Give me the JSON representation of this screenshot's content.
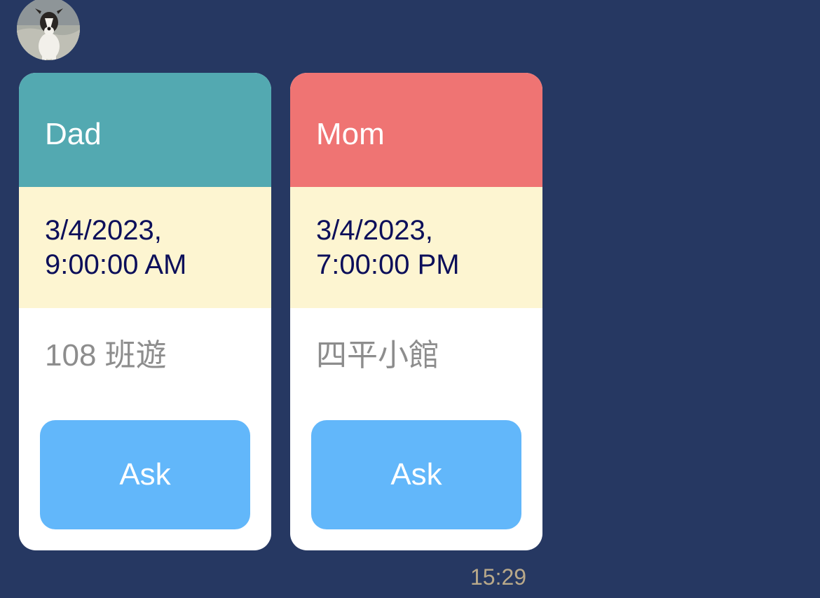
{
  "avatar": {
    "icon": "dog-photo-avatar"
  },
  "cards": [
    {
      "name": "Dad",
      "date": "3/4/2023,",
      "time": "9:00:00 AM",
      "place": "108 班遊",
      "button_label": "Ask",
      "header_color": "#53a9b1"
    },
    {
      "name": "Mom",
      "date": "3/4/2023,",
      "time": "7:00:00 PM",
      "place": "四平小館",
      "button_label": "Ask",
      "header_color": "#ef7473"
    }
  ],
  "timestamp": "15:29",
  "colors": {
    "background": "#263862",
    "time_band": "#fdf5d1",
    "button": "#62b7fa",
    "time_text": "#0c0f5a",
    "timestamp_text": "#b9a98a"
  }
}
